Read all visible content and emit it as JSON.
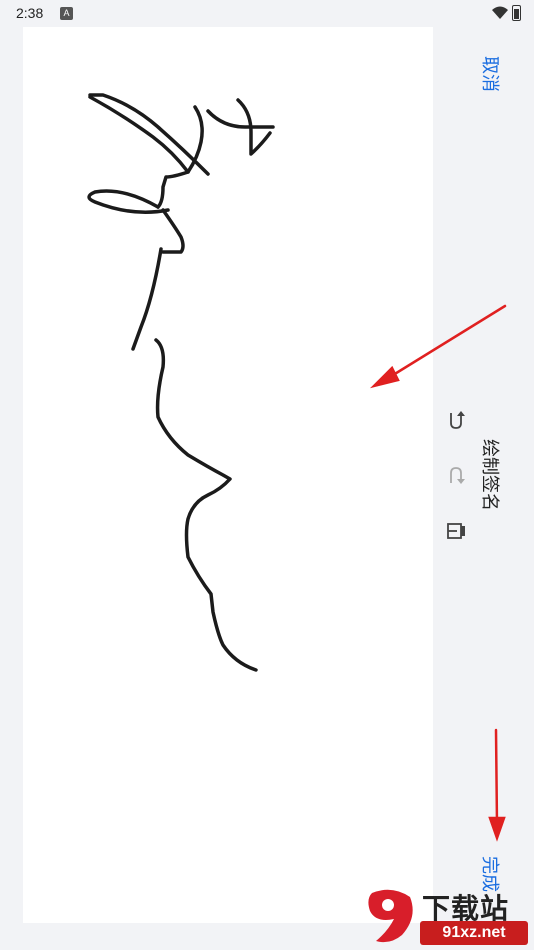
{
  "status_bar": {
    "time": "2:38",
    "notification_icon": "A"
  },
  "header": {
    "cancel_label": "取消",
    "title": "绘制签名",
    "done_label": "完成"
  },
  "tools": [
    {
      "name": "undo",
      "icon": "undo-icon"
    },
    {
      "name": "redo",
      "icon": "redo-icon"
    },
    {
      "name": "clear",
      "icon": "eraser-icon"
    }
  ],
  "annotations": {
    "arrow_color": "#e02020"
  },
  "colors": {
    "accent": "#1a6de0",
    "stroke": "#1b1b1b",
    "background": "#f2f3f6",
    "canvas": "#ffffff"
  },
  "watermark": {
    "brand": "下载站",
    "url": "91xz.net",
    "logo_text": "91"
  }
}
